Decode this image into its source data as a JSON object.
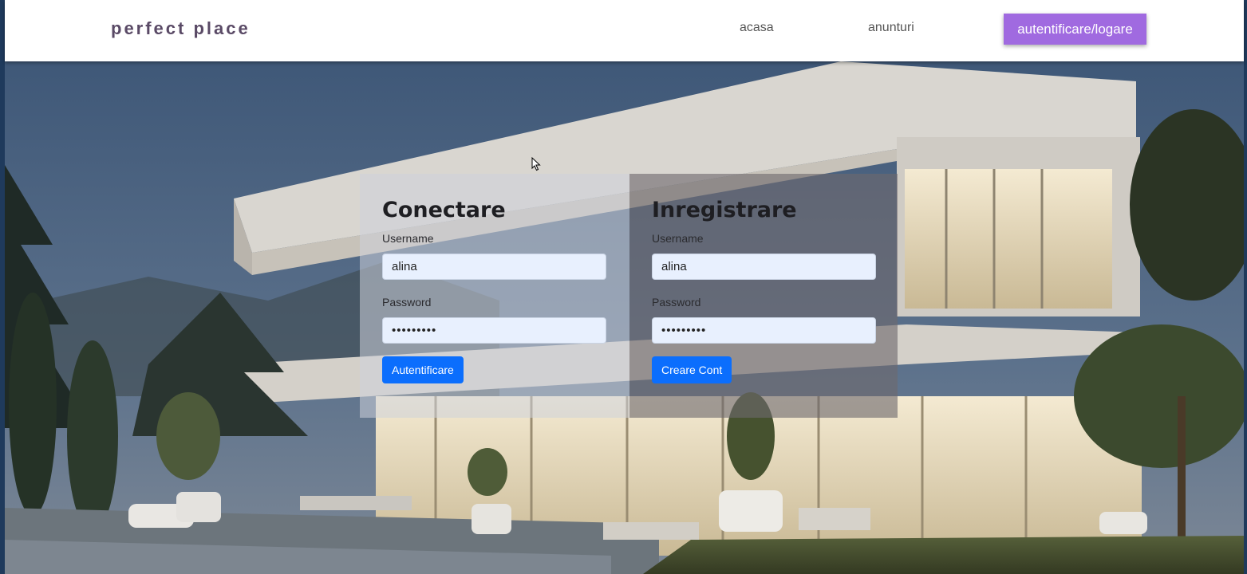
{
  "nav": {
    "brand": "perfect place",
    "links": [
      "acasa",
      "anunturi"
    ],
    "auth_label": "autentificare/logare"
  },
  "login": {
    "title": "Conectare",
    "username_label": "Username",
    "username_value": "alina",
    "password_label": "Password",
    "password_value": "•••••••••",
    "button_label": "Autentificare"
  },
  "register": {
    "title": "Inregistrare",
    "username_label": "Username",
    "username_value": "alina",
    "password_label": "Password",
    "password_value": "•••••••••",
    "button_label": "Creare Cont"
  },
  "colors": {
    "accent": "#a06ae0",
    "button": "#0b6efd",
    "brand": "#5a4a66"
  }
}
